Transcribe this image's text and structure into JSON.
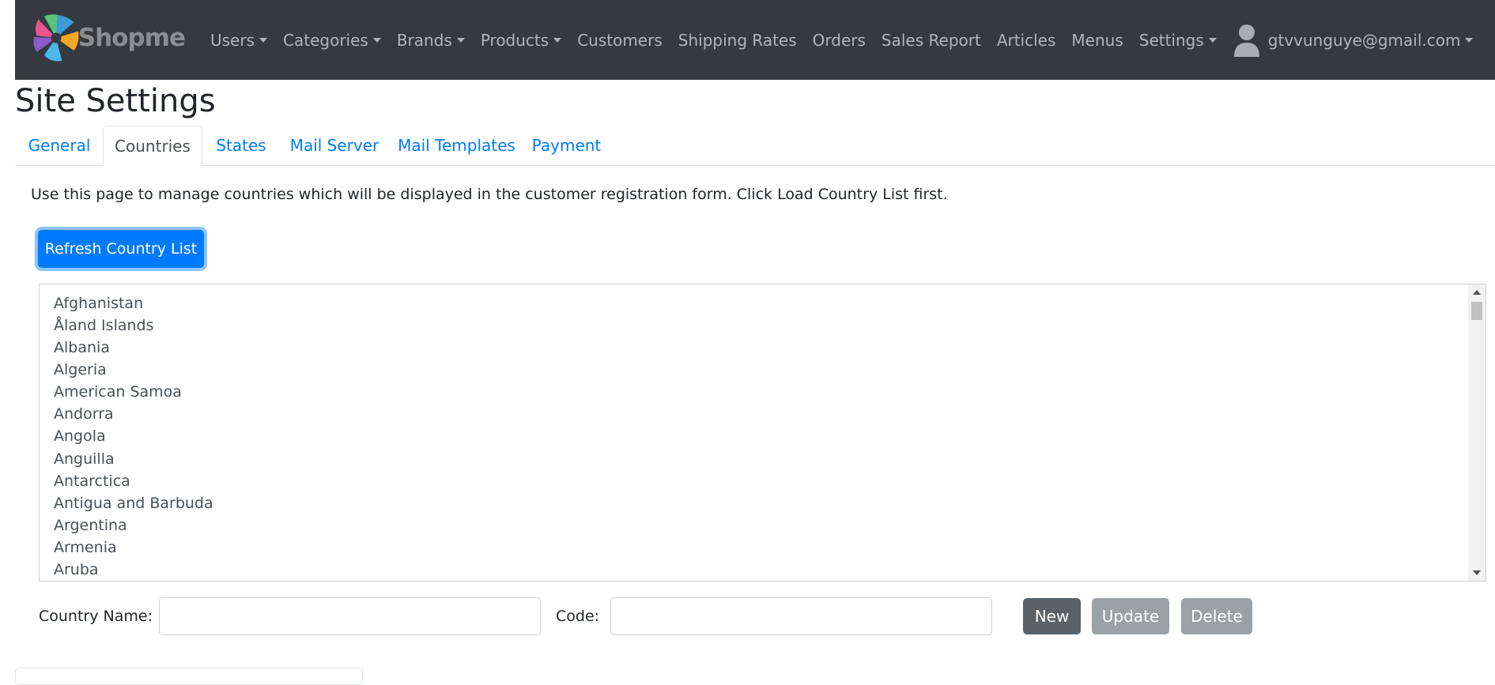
{
  "navbar": {
    "brand": "Shopme",
    "items": [
      {
        "label": "Users",
        "dropdown": true
      },
      {
        "label": "Categories",
        "dropdown": true
      },
      {
        "label": "Brands",
        "dropdown": true
      },
      {
        "label": "Products",
        "dropdown": true
      },
      {
        "label": "Customers",
        "dropdown": false
      },
      {
        "label": "Shipping Rates",
        "dropdown": false
      },
      {
        "label": "Orders",
        "dropdown": false
      },
      {
        "label": "Sales Report",
        "dropdown": false
      },
      {
        "label": "Articles",
        "dropdown": false
      },
      {
        "label": "Menus",
        "dropdown": false
      },
      {
        "label": "Settings",
        "dropdown": true
      }
    ],
    "user_email": "gtvvunguye@gmail.com",
    "user_icon": "user-icon"
  },
  "page": {
    "title": "Site Settings",
    "tabs": [
      "General",
      "Countries",
      "States",
      "Mail Server",
      "Mail Templates",
      "Payment"
    ],
    "active_tab": "Countries",
    "intro": "Use this page to manage countries which will be displayed in the customer registration form. Click Load Country List first.",
    "refresh_button": "Refresh Country List",
    "countries": [
      "Afghanistan",
      "Åland Islands",
      "Albania",
      "Algeria",
      "American Samoa",
      "Andorra",
      "Angola",
      "Anguilla",
      "Antarctica",
      "Antigua and Barbuda",
      "Argentina",
      "Armenia",
      "Aruba"
    ],
    "form": {
      "name_label": "Country Name:",
      "name_value": "",
      "code_label": "Code:",
      "code_value": "",
      "new_button": "New",
      "update_button": "Update",
      "delete_button": "Delete"
    }
  },
  "colors": {
    "navbar_bg": "#343a40",
    "primary": "#007bff",
    "secondary": "#6c757d"
  }
}
